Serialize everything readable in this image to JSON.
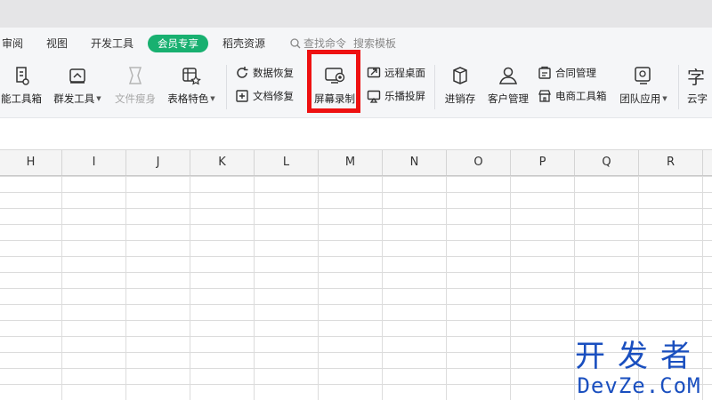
{
  "menu": {
    "items": [
      "审阅",
      "视图",
      "开发工具"
    ],
    "vip": "会员专享",
    "resources": "稻壳资源",
    "search_label": "查找命令",
    "search_placeholder": "搜索模板"
  },
  "ribbon": {
    "smart_toolbox": "能工具箱",
    "group_tools": "群发工具",
    "file_slim": "文件瘦身",
    "table_feature": "表格特色",
    "data_recovery": "数据恢复",
    "doc_repair": "文档修复",
    "screen_record": "屏幕录制",
    "remote_desktop": "远程桌面",
    "happy_cast": "乐播投屏",
    "inventory": "进销存",
    "customer_mgmt": "客户管理",
    "contract_mgmt": "合同管理",
    "ecommerce_toolbox": "电商工具箱",
    "team_apps": "团队应用",
    "cloud_font": "云字"
  },
  "columns": [
    "H",
    "I",
    "J",
    "K",
    "L",
    "M",
    "N",
    "O",
    "P",
    "Q",
    "R"
  ],
  "watermark": {
    "cn": "开发者",
    "en": "DevZe.CoM"
  },
  "colors": {
    "vip_green": "#18b070",
    "highlight_red": "#ee1111",
    "watermark_blue": "#1a4fbf"
  }
}
